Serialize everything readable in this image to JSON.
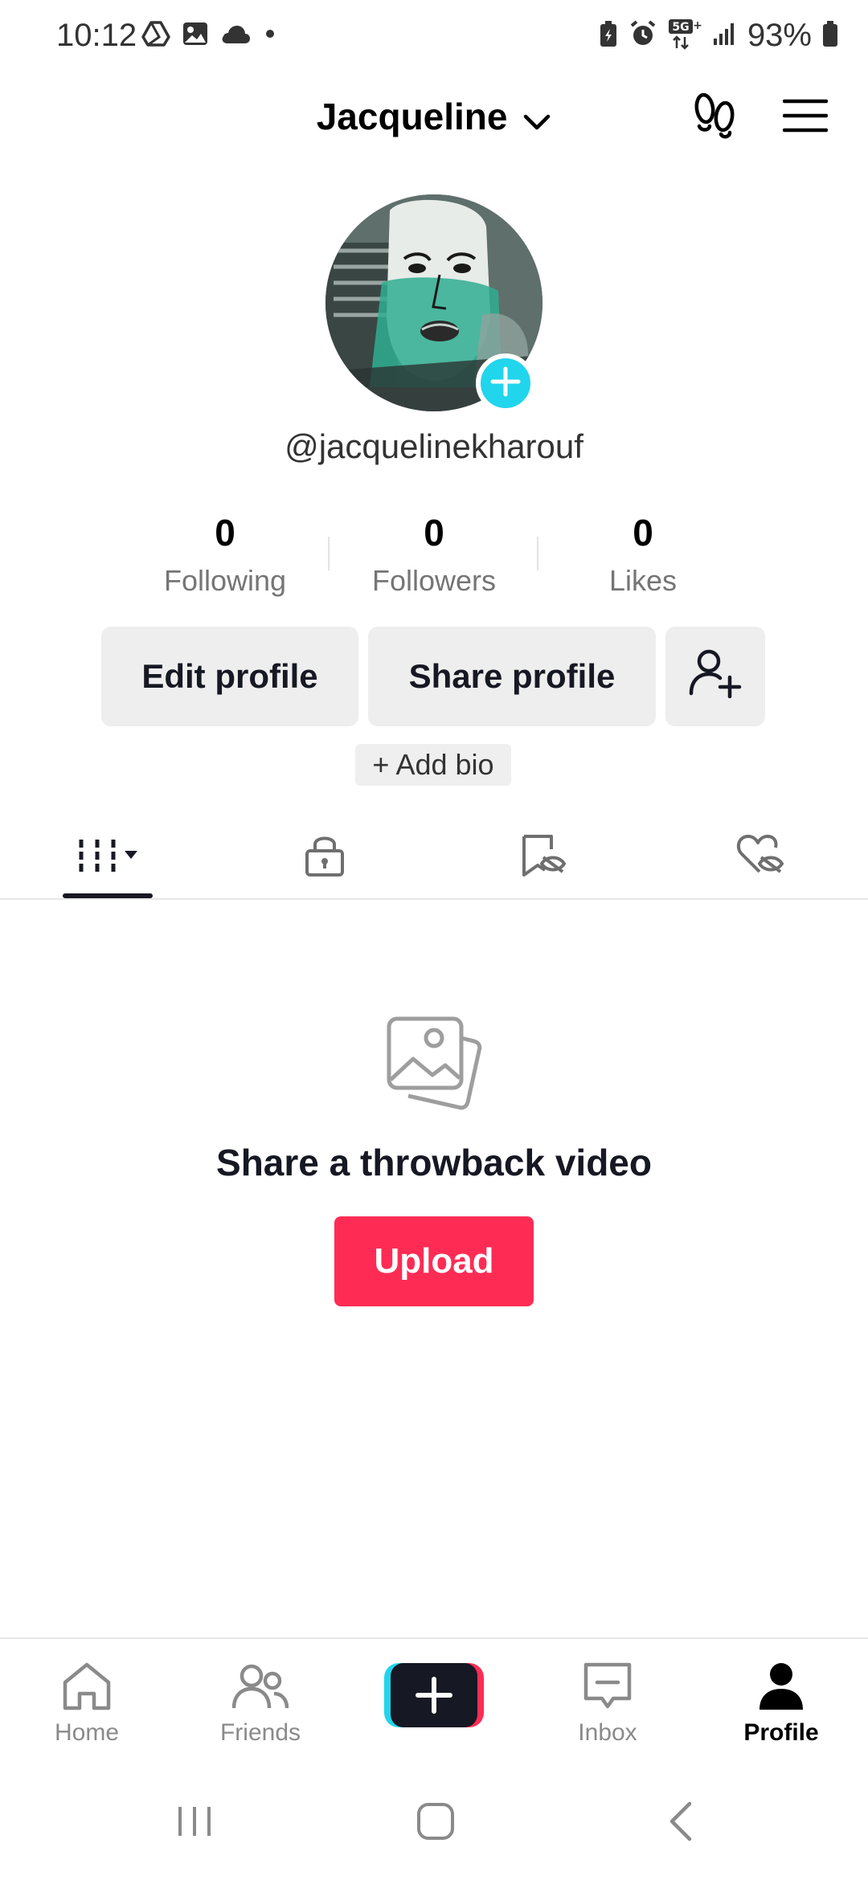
{
  "status_bar": {
    "time": "10:12",
    "battery_percent": "93%",
    "left_icons": [
      "drive-icon",
      "photo-icon",
      "cloud-icon",
      "dot-icon"
    ],
    "right_icons": [
      "battery-saver-icon",
      "alarm-icon",
      "5g-icon",
      "signal-icon",
      "battery-icon"
    ]
  },
  "header": {
    "account_name": "Jacqueline",
    "icons": [
      "chevron-down-icon",
      "footprint-icon",
      "menu-icon"
    ]
  },
  "profile": {
    "username": "@jacquelinekharouf",
    "stats": [
      {
        "value": "0",
        "label": "Following"
      },
      {
        "value": "0",
        "label": "Followers"
      },
      {
        "value": "0",
        "label": "Likes"
      }
    ],
    "edit_profile_label": "Edit profile",
    "share_profile_label": "Share profile",
    "add_bio_label": "+ Add bio"
  },
  "tabs": [
    {
      "name": "videos-grid",
      "icon": "grid-icon",
      "active": true
    },
    {
      "name": "private",
      "icon": "lock-icon",
      "active": false
    },
    {
      "name": "favorites",
      "icon": "bookmark-hidden-icon",
      "active": false
    },
    {
      "name": "liked",
      "icon": "heart-hidden-icon",
      "active": false
    }
  ],
  "empty_state": {
    "title": "Share a throwback video",
    "button_label": "Upload"
  },
  "bottom_nav": [
    {
      "label": "Home",
      "icon": "home-icon",
      "active": false
    },
    {
      "label": "Friends",
      "icon": "friends-icon",
      "active": false
    },
    {
      "label": "",
      "icon": "plus-icon",
      "active": false
    },
    {
      "label": "Inbox",
      "icon": "inbox-icon",
      "active": false
    },
    {
      "label": "Profile",
      "icon": "profile-icon",
      "active": true
    }
  ],
  "colors": {
    "accent_red": "#fe2c55",
    "accent_cyan": "#20d5ec",
    "text_primary": "#161823",
    "text_secondary": "#757575",
    "button_gray": "#eeeeee"
  }
}
